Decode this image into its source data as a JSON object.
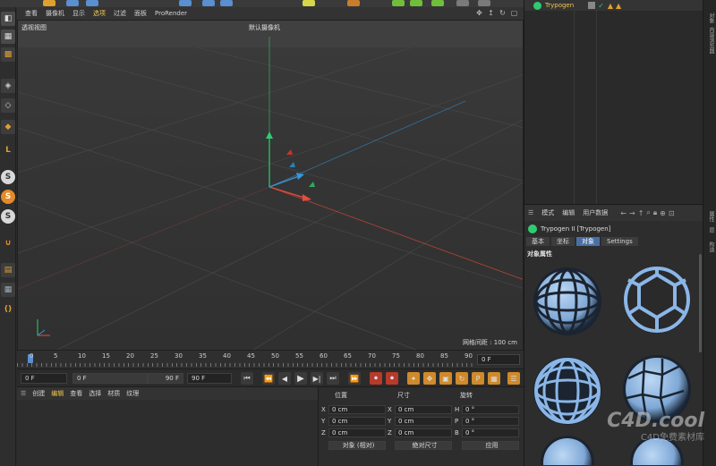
{
  "viewport_menu": {
    "items": [
      "查看",
      "摄像机",
      "显示",
      "选项",
      "过滤",
      "面板",
      "ProRender"
    ],
    "active_index": 3
  },
  "viewport": {
    "view_name": "透视视图",
    "camera_name": "默认摄像机",
    "grid_spacing": "网格间距 : 100 cm"
  },
  "timeline": {
    "ticks": [
      "0",
      "5",
      "10",
      "15",
      "20",
      "25",
      "30",
      "35",
      "40",
      "45",
      "50",
      "55",
      "60",
      "65",
      "70",
      "75",
      "80",
      "85",
      "90"
    ],
    "current_frame": "0 F"
  },
  "transport": {
    "start_field": "0 F",
    "range_start": "0 F",
    "range_end": "90 F",
    "end_field": "90 F"
  },
  "materials": {
    "menu": [
      "创建",
      "编辑",
      "查看",
      "选择",
      "材质",
      "纹理"
    ]
  },
  "coords": {
    "headers": {
      "position": "位置",
      "size": "尺寸",
      "rotation": "旋转"
    },
    "rows": [
      {
        "axis": "X",
        "pos": "0 cm",
        "size_axis": "X",
        "size": "0 cm",
        "rot_axis": "H",
        "rot": "0 °"
      },
      {
        "axis": "Y",
        "pos": "0 cm",
        "size_axis": "Y",
        "size": "0 cm",
        "rot_axis": "P",
        "rot": "0 °"
      },
      {
        "axis": "Z",
        "pos": "0 cm",
        "size_axis": "Z",
        "size": "0 cm",
        "rot_axis": "B",
        "rot": "0 °"
      }
    ],
    "mode_select": "对象 (相对)",
    "size_select": "绝对尺寸",
    "apply_label": "应用"
  },
  "object_manager": {
    "object_name": "Trypogen"
  },
  "attributes": {
    "menu": [
      "模式",
      "编辑",
      "用户数据"
    ],
    "title": "Trypogen II [Trypogen]",
    "tabs": [
      "基本",
      "坐标",
      "对象",
      "Settings"
    ],
    "active_tab": 2,
    "section": "对象属性"
  },
  "side_tabs": [
    "对象",
    "内容浏览器",
    "属性",
    "层",
    "构造"
  ],
  "watermark": {
    "main": "C4D.cool",
    "sub": "C4D免费素材库"
  },
  "colors": {
    "accent_blue": "#4a6fa5",
    "active_menu": "#f2c94c",
    "sphere_fill": "#8ab6e8",
    "axis_green": "#2ecc71",
    "axis_red": "#e74c3c",
    "axis_blue": "#3498db"
  }
}
